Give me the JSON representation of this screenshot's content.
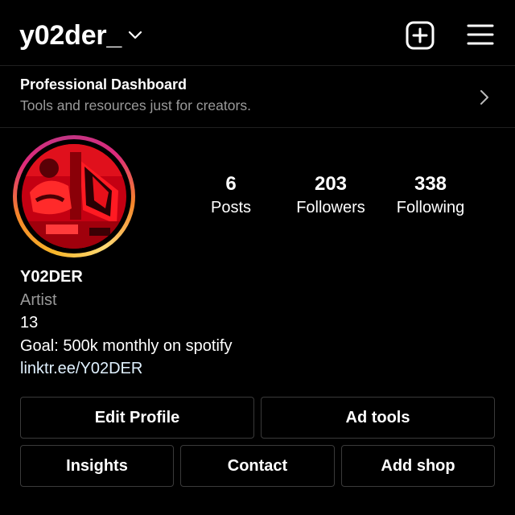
{
  "header": {
    "username": "y02der_",
    "new_post_icon": "plus-square-icon",
    "menu_icon": "hamburger-menu-icon"
  },
  "dashboard": {
    "title": "Professional Dashboard",
    "subtitle": "Tools and resources just for creators."
  },
  "profile": {
    "stats": [
      {
        "value": "6",
        "label": "Posts"
      },
      {
        "value": "203",
        "label": "Followers"
      },
      {
        "value": "338",
        "label": "Following"
      }
    ],
    "name": "Y02DER",
    "category": "Artist",
    "bio_lines": [
      "13",
      "Goal: 500k monthly on spotify"
    ],
    "link": "linktr.ee/Y02DER"
  },
  "actions": {
    "edit_profile": "Edit Profile",
    "ad_tools": "Ad tools",
    "insights": "Insights",
    "contact": "Contact",
    "add_shop": "Add shop"
  },
  "colors": {
    "background": "#000000",
    "secondary_text": "#9a9a9a",
    "button_border": "#3a3a3a",
    "story_ring": [
      "#f7b52a",
      "#dd2a7b",
      "#c13584"
    ]
  }
}
